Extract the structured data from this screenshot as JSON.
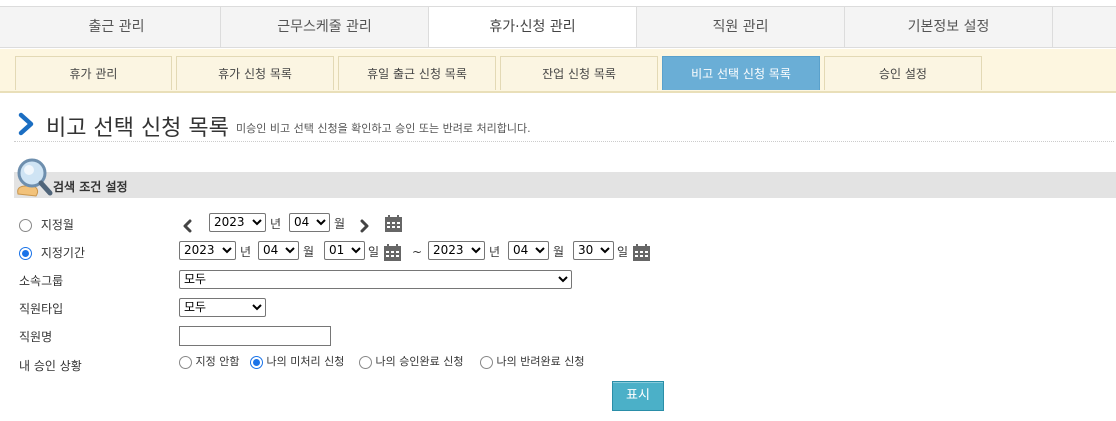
{
  "main_tabs": [
    {
      "label": "출근 관리"
    },
    {
      "label": "근무스케줄 관리"
    },
    {
      "label": "휴가·신청 관리"
    },
    {
      "label": "직원 관리"
    },
    {
      "label": "기본정보 설정"
    }
  ],
  "sub_tabs": [
    {
      "label": "휴가 관리"
    },
    {
      "label": "휴가 신청 목록"
    },
    {
      "label": "휴일 출근 신청 목록"
    },
    {
      "label": "잔업 신청 목록"
    },
    {
      "label": "비고 선택 신청 목록"
    },
    {
      "label": "승인 설정"
    }
  ],
  "page": {
    "title": "비고 선택 신청 목록",
    "description": "미승인 비고 선택 신청을 확인하고 승인 또는 반려로 처리합니다."
  },
  "search": {
    "title": "검색 조건 설정",
    "month_label": "지정월",
    "month_year": "2023",
    "month_month": "04",
    "unit_year": "년",
    "unit_month": "월",
    "unit_day": "일",
    "period_label": "지정기간",
    "period_start_year": "2023",
    "period_start_month": "04",
    "period_start_day": "01",
    "tilde": "~",
    "period_end_year": "2023",
    "period_end_month": "04",
    "period_end_day": "30",
    "group_label": "소속그룹",
    "group_value": "모두",
    "type_label": "직원타입",
    "type_value": "모두",
    "name_label": "직원명",
    "name_value": "",
    "status_label": "내 승인 상황",
    "status_options": [
      {
        "label": "지정 안함"
      },
      {
        "label": "나의 미처리 신청"
      },
      {
        "label": "나의 승인완료 신청"
      },
      {
        "label": "나의 반려완료 신청"
      }
    ],
    "show_button": "표시"
  },
  "colors": {
    "active_subtab": "#6aaed6",
    "show_button": "#4bb0c8",
    "title_chevron": "#1b6ec2"
  }
}
